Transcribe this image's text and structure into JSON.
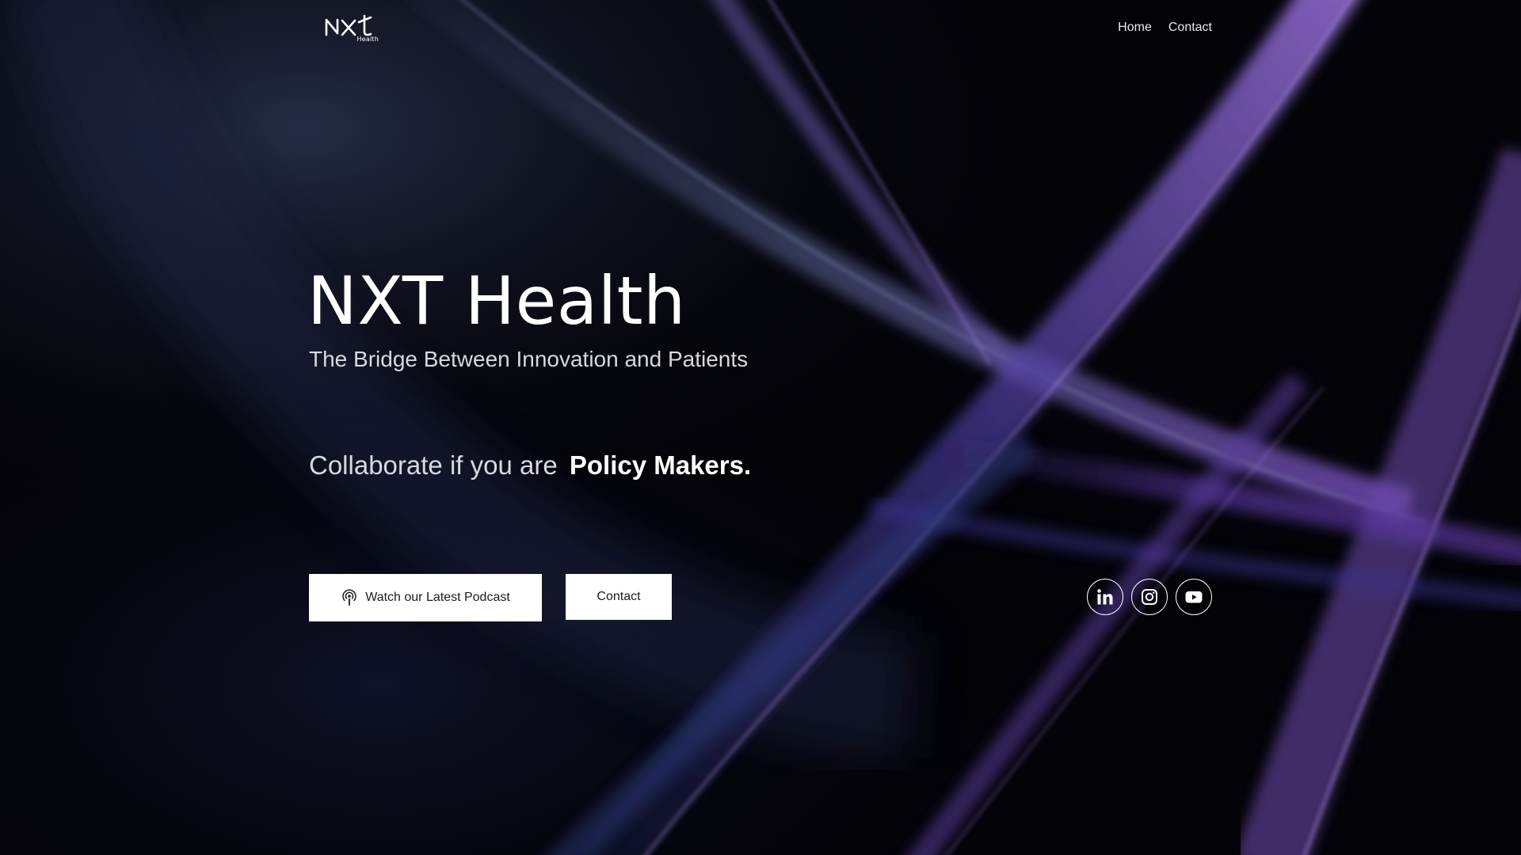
{
  "brand": {
    "logo_text": "NXT",
    "logo_sub": "Health"
  },
  "nav": {
    "items": [
      {
        "label": "Home"
      },
      {
        "label": "Contact"
      }
    ]
  },
  "hero": {
    "title": "NXT Health",
    "subtitle": "The Bridge Between Innovation and Patients",
    "collab_lead": "Collaborate if you are",
    "collab_audience": "Policy Makers."
  },
  "actions": {
    "podcast_label": "Watch our Latest Podcast",
    "contact_label": "Contact"
  },
  "social": {
    "items": [
      {
        "icon": "linkedin-icon"
      },
      {
        "icon": "instagram-icon"
      },
      {
        "icon": "youtube-icon"
      }
    ]
  },
  "colors": {
    "background": "#030308",
    "accent_purple": "#6a3fb5",
    "accent_blue": "#3a4a9a",
    "text": "#ffffff",
    "button_bg": "#ffffff",
    "button_text": "#1a1a22"
  }
}
